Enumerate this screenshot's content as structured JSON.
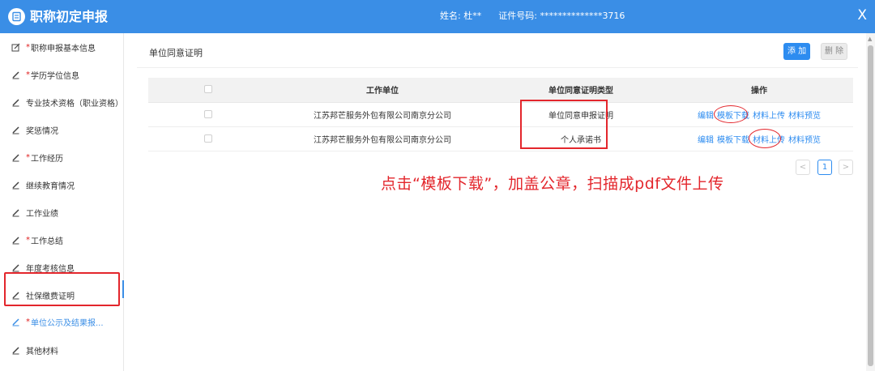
{
  "header": {
    "title": "职称初定申报",
    "name_label": "姓名:",
    "name_value": "杜**",
    "id_label": "证件号码:",
    "id_value": "**************3716",
    "close": "X"
  },
  "sidebar": {
    "items": [
      {
        "label": "职称申报基本信息",
        "required": "*",
        "icon": "edit-square-icon"
      },
      {
        "label": "学历学位信息",
        "required": "*",
        "icon": "pencil-icon"
      },
      {
        "label": "专业技术资格（职业资格）",
        "required": "",
        "icon": "pencil-icon"
      },
      {
        "label": "奖惩情况",
        "required": "",
        "icon": "pencil-icon"
      },
      {
        "label": "工作经历",
        "required": "*",
        "icon": "pencil-icon"
      },
      {
        "label": "继续教育情况",
        "required": "",
        "icon": "pencil-icon"
      },
      {
        "label": "工作业绩",
        "required": "",
        "icon": "pencil-icon"
      },
      {
        "label": "工作总结",
        "required": "*",
        "icon": "pencil-icon"
      },
      {
        "label": "年度考核信息",
        "required": "",
        "icon": "pencil-icon"
      },
      {
        "label": "社保缴费证明",
        "required": "",
        "icon": "pencil-icon"
      },
      {
        "label": "单位公示及结果报...",
        "required": "*",
        "icon": "pencil-icon",
        "active": true
      },
      {
        "label": "其他材料",
        "required": "",
        "icon": "pencil-icon"
      }
    ]
  },
  "main": {
    "panel_title": "单位同意证明",
    "add_label": "添 加",
    "delete_label": "删 除",
    "table": {
      "columns": [
        "",
        "工作单位",
        "单位同意证明类型",
        "操作"
      ],
      "rows": [
        {
          "unit": "江苏邦芒服务外包有限公司南京分公司",
          "type": "单位同意申报证明",
          "ops": [
            "编辑",
            "模板下载",
            "材料上传",
            "材料预览"
          ]
        },
        {
          "unit": "江苏邦芒服务外包有限公司南京分公司",
          "type": "个人承诺书",
          "ops": [
            "编辑",
            "模板下载",
            "材料上传",
            "材料预览"
          ]
        }
      ]
    },
    "pagination": {
      "prev": "<",
      "current": "1",
      "next": ">"
    },
    "annotation": "点击“模板下载”，加盖公章，扫描成pdf文件上传"
  },
  "colors": {
    "primary": "#3a8ee6",
    "button": "#2d8cf0",
    "annotation": "#e3262c"
  }
}
